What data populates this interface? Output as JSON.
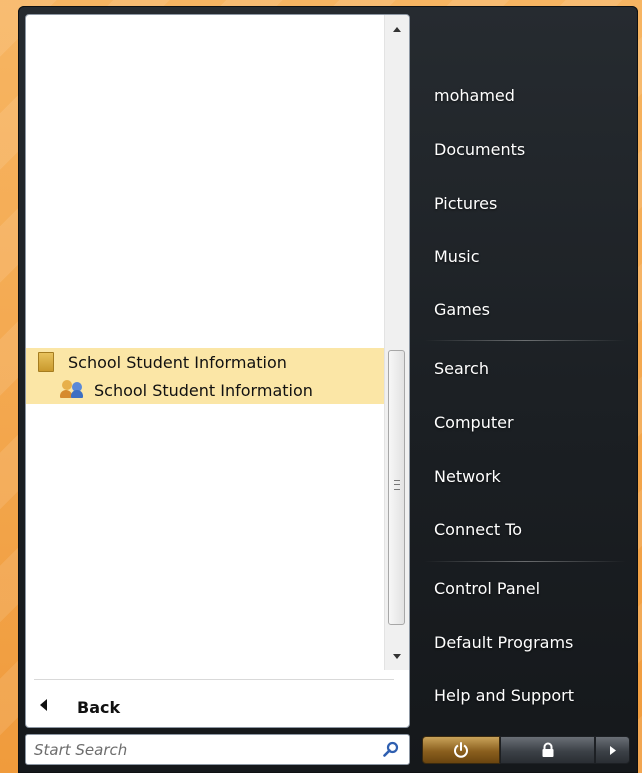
{
  "programs": {
    "folder_label": "School  Student Information",
    "app_label": "School  Student Information",
    "back_label": "Back"
  },
  "search": {
    "placeholder": "Start Search"
  },
  "right_menu": {
    "user": "mohamed",
    "documents": "Documents",
    "pictures": "Pictures",
    "music": "Music",
    "games": "Games",
    "search": "Search",
    "computer": "Computer",
    "network": "Network",
    "connect_to": "Connect To",
    "control_panel": "Control Panel",
    "default_programs": "Default Programs",
    "help_support": "Help and Support"
  },
  "colors": {
    "highlight": "#fbe6a6",
    "menu_dark": "#1b1f23",
    "power_button": "#8a5f1e",
    "backdrop": "#f3a24a"
  },
  "icons": {
    "folder": "folder-icon",
    "app": "users-icon",
    "back": "back-arrow-icon",
    "search": "search-icon",
    "power": "power-icon",
    "lock": "lock-icon",
    "more": "chevron-right-icon"
  }
}
